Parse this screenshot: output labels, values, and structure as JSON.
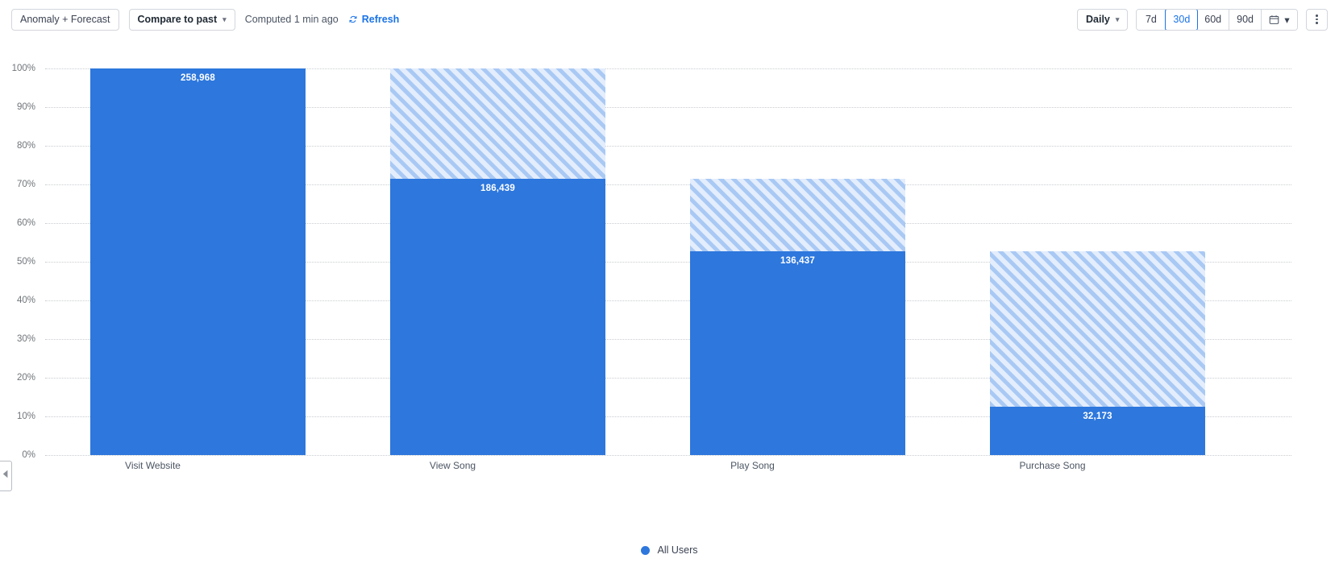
{
  "toolbar": {
    "anomaly_forecast_label": "Anomaly + Forecast",
    "compare_label": "Compare to past",
    "computed_text": "Computed 1 min ago",
    "refresh_label": "Refresh",
    "refresh_icon": "refresh-icon",
    "granularity_label": "Daily",
    "ranges": [
      {
        "label": "7d",
        "active": false
      },
      {
        "label": "30d",
        "active": true
      },
      {
        "label": "60d",
        "active": false
      },
      {
        "label": "90d",
        "active": false
      }
    ],
    "calendar_icon": "calendar-icon",
    "more_menu_icon": "kebab-menu-icon",
    "accent_color": "#1a73e8"
  },
  "collapse_handle": {
    "icon": "chevron-left-icon"
  },
  "legend": {
    "items": [
      {
        "label": "All Users",
        "color": "#2d77dd"
      }
    ]
  },
  "chart_data": {
    "type": "bar",
    "title": "",
    "xlabel": "",
    "ylabel": "",
    "ylim": [
      0,
      100
    ],
    "grid": true,
    "legend_position": "bottom",
    "categories": [
      "Visit Website",
      "View Song",
      "Play Song",
      "Purchase Song"
    ],
    "ytick_labels": [
      "100%",
      "90%",
      "80%",
      "70%",
      "60%",
      "50%",
      "40%",
      "30%",
      "20%",
      "10%",
      "0%"
    ],
    "ytick_values": [
      100,
      90,
      80,
      70,
      60,
      50,
      40,
      30,
      20,
      10,
      0
    ],
    "series": [
      {
        "name": "All Users",
        "color": "#2d77dd",
        "values": [
          100.0,
          71.5,
          52.8,
          12.5
        ],
        "data_labels": [
          "258,968",
          "186,439",
          "136,437",
          "32,173"
        ],
        "counts": [
          258968,
          186439,
          136437,
          32173
        ]
      },
      {
        "name": "Forecast",
        "color": "#e3edfc",
        "pattern": "diagonal-hatch",
        "tops": [
          100.0,
          100.0,
          71.5,
          52.8
        ],
        "bottoms": [
          100.0,
          71.5,
          52.8,
          12.5
        ]
      }
    ]
  }
}
